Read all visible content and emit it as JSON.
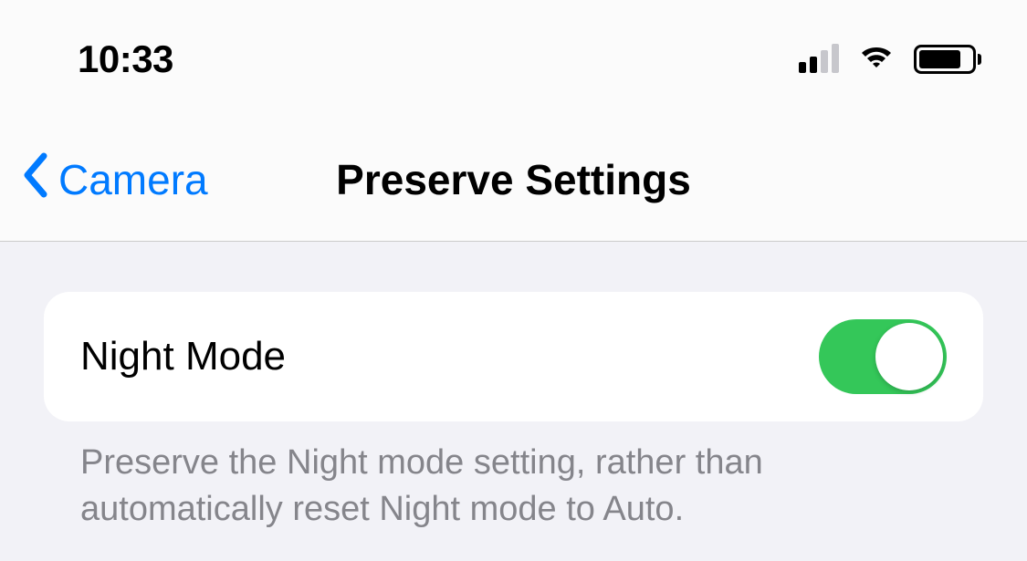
{
  "status": {
    "time": "10:33"
  },
  "nav": {
    "back_label": "Camera",
    "title": "Preserve Settings"
  },
  "settings": {
    "night_mode": {
      "label": "Night Mode",
      "enabled": true,
      "description": "Preserve the Night mode setting, rather than automatically reset Night mode to Auto."
    }
  }
}
